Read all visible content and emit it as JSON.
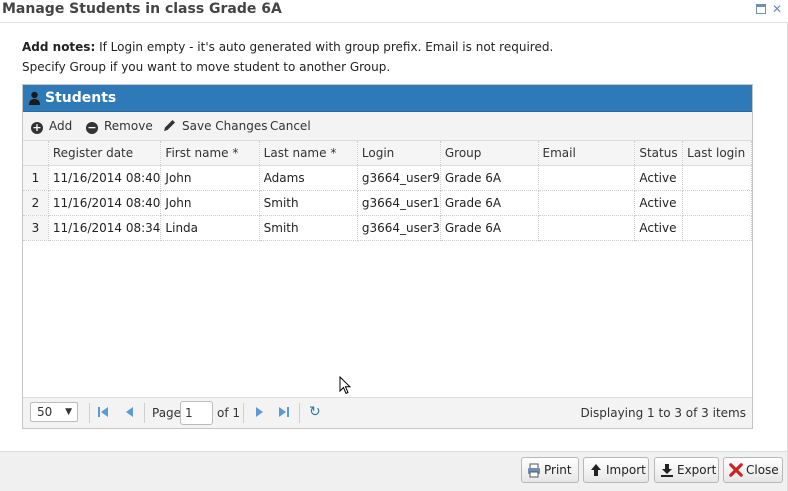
{
  "dialog": {
    "title": "Manage Students in class Grade 6A"
  },
  "notes": {
    "bold": "Add notes:",
    "line1": " If Login empty - it's auto generated with group prefix. Email is not required.",
    "line2": "Specify Group if you want to move student to another Group."
  },
  "panel": {
    "title": "Students"
  },
  "toolbar": {
    "add": "Add",
    "remove": "Remove",
    "save": "Save Changes",
    "cancel": "Cancel"
  },
  "columns": [
    "",
    "Register date",
    "First name *",
    "Last name *",
    "Login",
    "Group",
    "Email",
    "Status",
    "Last login"
  ],
  "rows": [
    {
      "num": "1",
      "register": "11/16/2014 08:40",
      "first": "John",
      "last": "Adams",
      "login": "g3664_user9",
      "group": "Grade 6A",
      "email": "",
      "status": "Active",
      "lastlogin": ""
    },
    {
      "num": "2",
      "register": "11/16/2014 08:40",
      "first": "John",
      "last": "Smith",
      "login": "g3664_user1",
      "group": "Grade 6A",
      "email": "",
      "status": "Active",
      "lastlogin": ""
    },
    {
      "num": "3",
      "register": "11/16/2014 08:34",
      "first": "Linda",
      "last": "Smith",
      "login": "g3664_user3",
      "group": "Grade 6A",
      "email": "",
      "status": "Active",
      "lastlogin": ""
    }
  ],
  "pager": {
    "page_size": "50",
    "page_label": "Page",
    "page_value": "1",
    "of_label": "of 1",
    "display": "Displaying 1 to 3 of 3 items"
  },
  "footer": {
    "print": "Print",
    "import": "Import",
    "export": "Export",
    "close": "Close"
  },
  "colors": {
    "header_blue": "#2e7ab8",
    "nav_blue": "#5b9bd5",
    "close_red": "#cc2222"
  }
}
